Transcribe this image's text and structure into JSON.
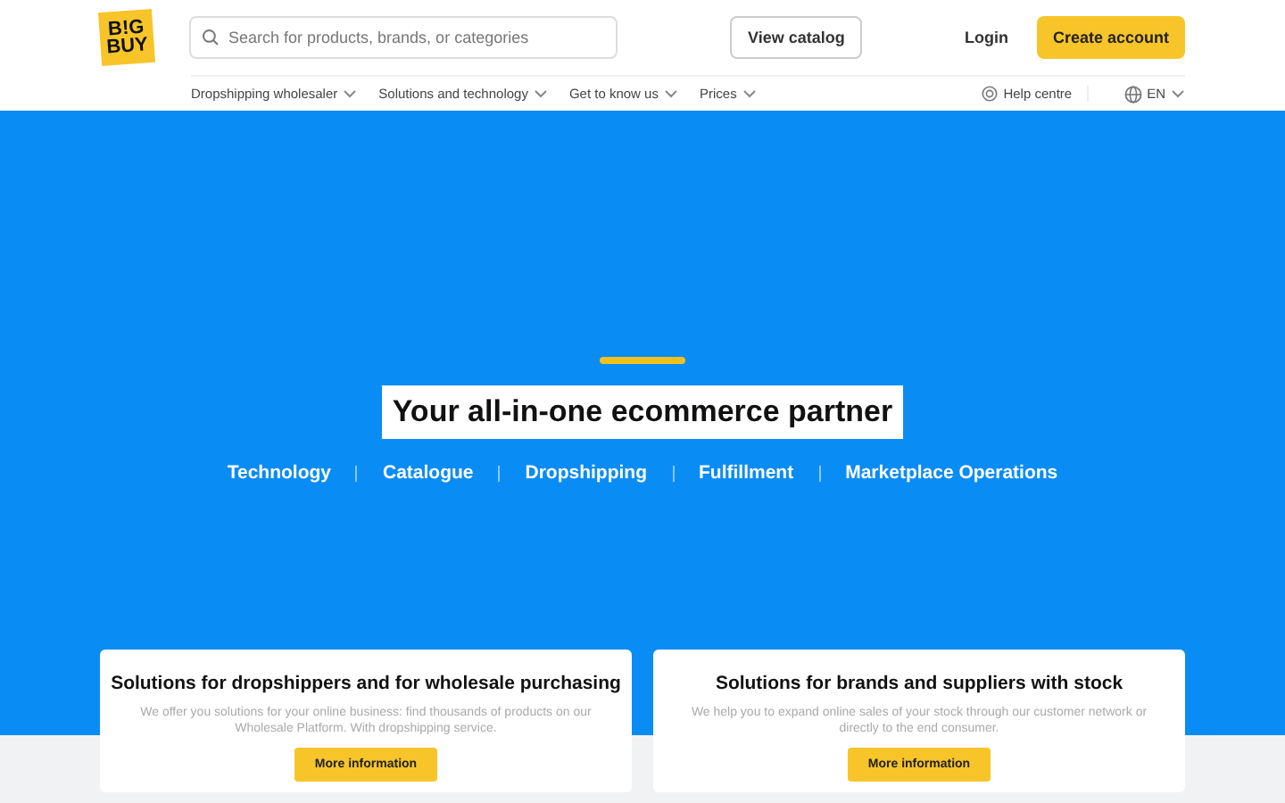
{
  "logo": {
    "lines": [
      "B!G",
      "BUY"
    ]
  },
  "search": {
    "placeholder": "Search for products, brands, or categories"
  },
  "header_buttons": {
    "catalog": "View catalog",
    "login": "Login",
    "create": "Create account"
  },
  "nav": [
    {
      "label": "Dropshipping wholesaler"
    },
    {
      "label": "Solutions and technology"
    },
    {
      "label": "Get to know us"
    },
    {
      "label": "Prices"
    }
  ],
  "help": "Help centre",
  "language": "EN",
  "hero": {
    "title": "Your all-in-one ecommerce partner",
    "links": [
      "Technology",
      "Catalogue",
      "Dropshipping",
      "Fulfillment",
      "Marketplace Operations"
    ]
  },
  "cards": [
    {
      "title": "Solutions for dropshippers and for wholesale purchasing",
      "text": "We offer you solutions for your online business: find thousands of products on our Wholesale Platform. With dropshipping service.",
      "button": "More information"
    },
    {
      "title": "Solutions for brands and suppliers with stock",
      "text": "We help you to expand online sales of your stock through our customer network or directly to the end consumer.",
      "button": "More information"
    }
  ]
}
